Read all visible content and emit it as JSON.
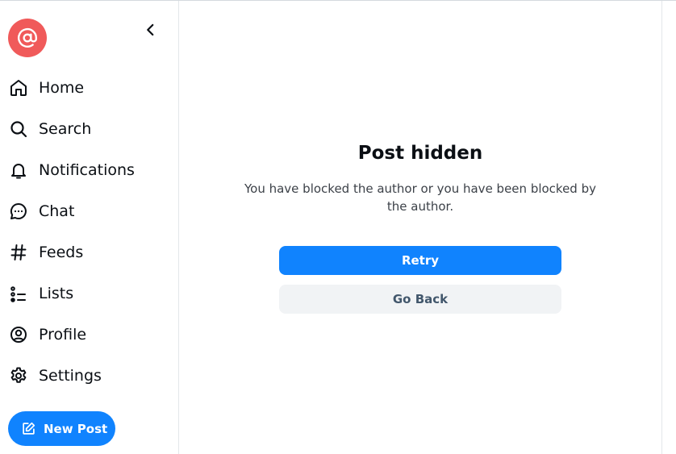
{
  "sidebar": {
    "logo_icon": "at-sign-icon",
    "collapse_icon": "chevron-left-icon",
    "items": [
      {
        "label": "Home",
        "icon": "home-icon"
      },
      {
        "label": "Search",
        "icon": "search-icon"
      },
      {
        "label": "Notifications",
        "icon": "bell-icon"
      },
      {
        "label": "Chat",
        "icon": "chat-bubble-icon"
      },
      {
        "label": "Feeds",
        "icon": "hashtag-icon"
      },
      {
        "label": "Lists",
        "icon": "list-icon"
      },
      {
        "label": "Profile",
        "icon": "user-circle-icon"
      },
      {
        "label": "Settings",
        "icon": "gear-icon"
      }
    ],
    "new_post": {
      "label": "New Post",
      "icon": "edit-icon"
    }
  },
  "main": {
    "title": "Post hidden",
    "message": "You have blocked the author or you have been blocked by the author.",
    "retry_label": "Retry",
    "back_label": "Go Back"
  },
  "colors": {
    "accent": "#1083fe",
    "logo": "#f05a5a",
    "secondary_button": "#f1f3f5",
    "secondary_text": "#42576c"
  }
}
